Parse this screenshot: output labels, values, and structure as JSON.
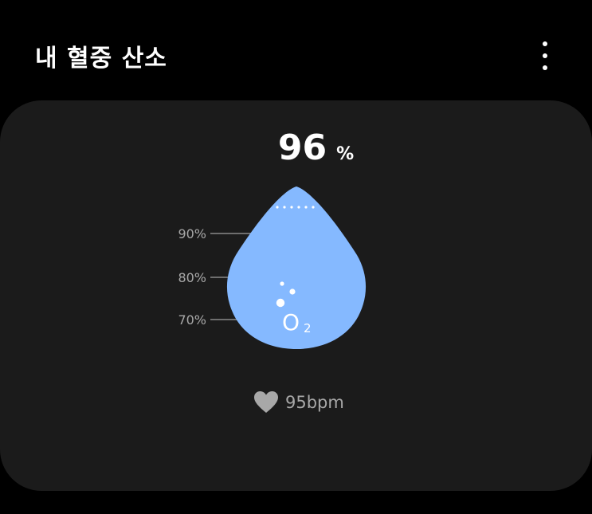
{
  "header": {
    "title": "내 혈중 산소"
  },
  "card": {
    "spo2_value": "96",
    "spo2_unit": "%",
    "spo2_level": 0.96,
    "scale_labels": [
      "90%",
      "80%",
      "70%"
    ],
    "o2_letter": "O",
    "o2_subscript": "2",
    "heart_rate": "95bpm"
  },
  "colors": {
    "background": "#000000",
    "card": "#1b1b1b",
    "drop": "#85b9ff",
    "muted_text": "#a8a8a8"
  },
  "icons": {
    "menu": "more-vertical-icon",
    "heart": "heart-icon",
    "drop": "blood-drop-icon"
  }
}
